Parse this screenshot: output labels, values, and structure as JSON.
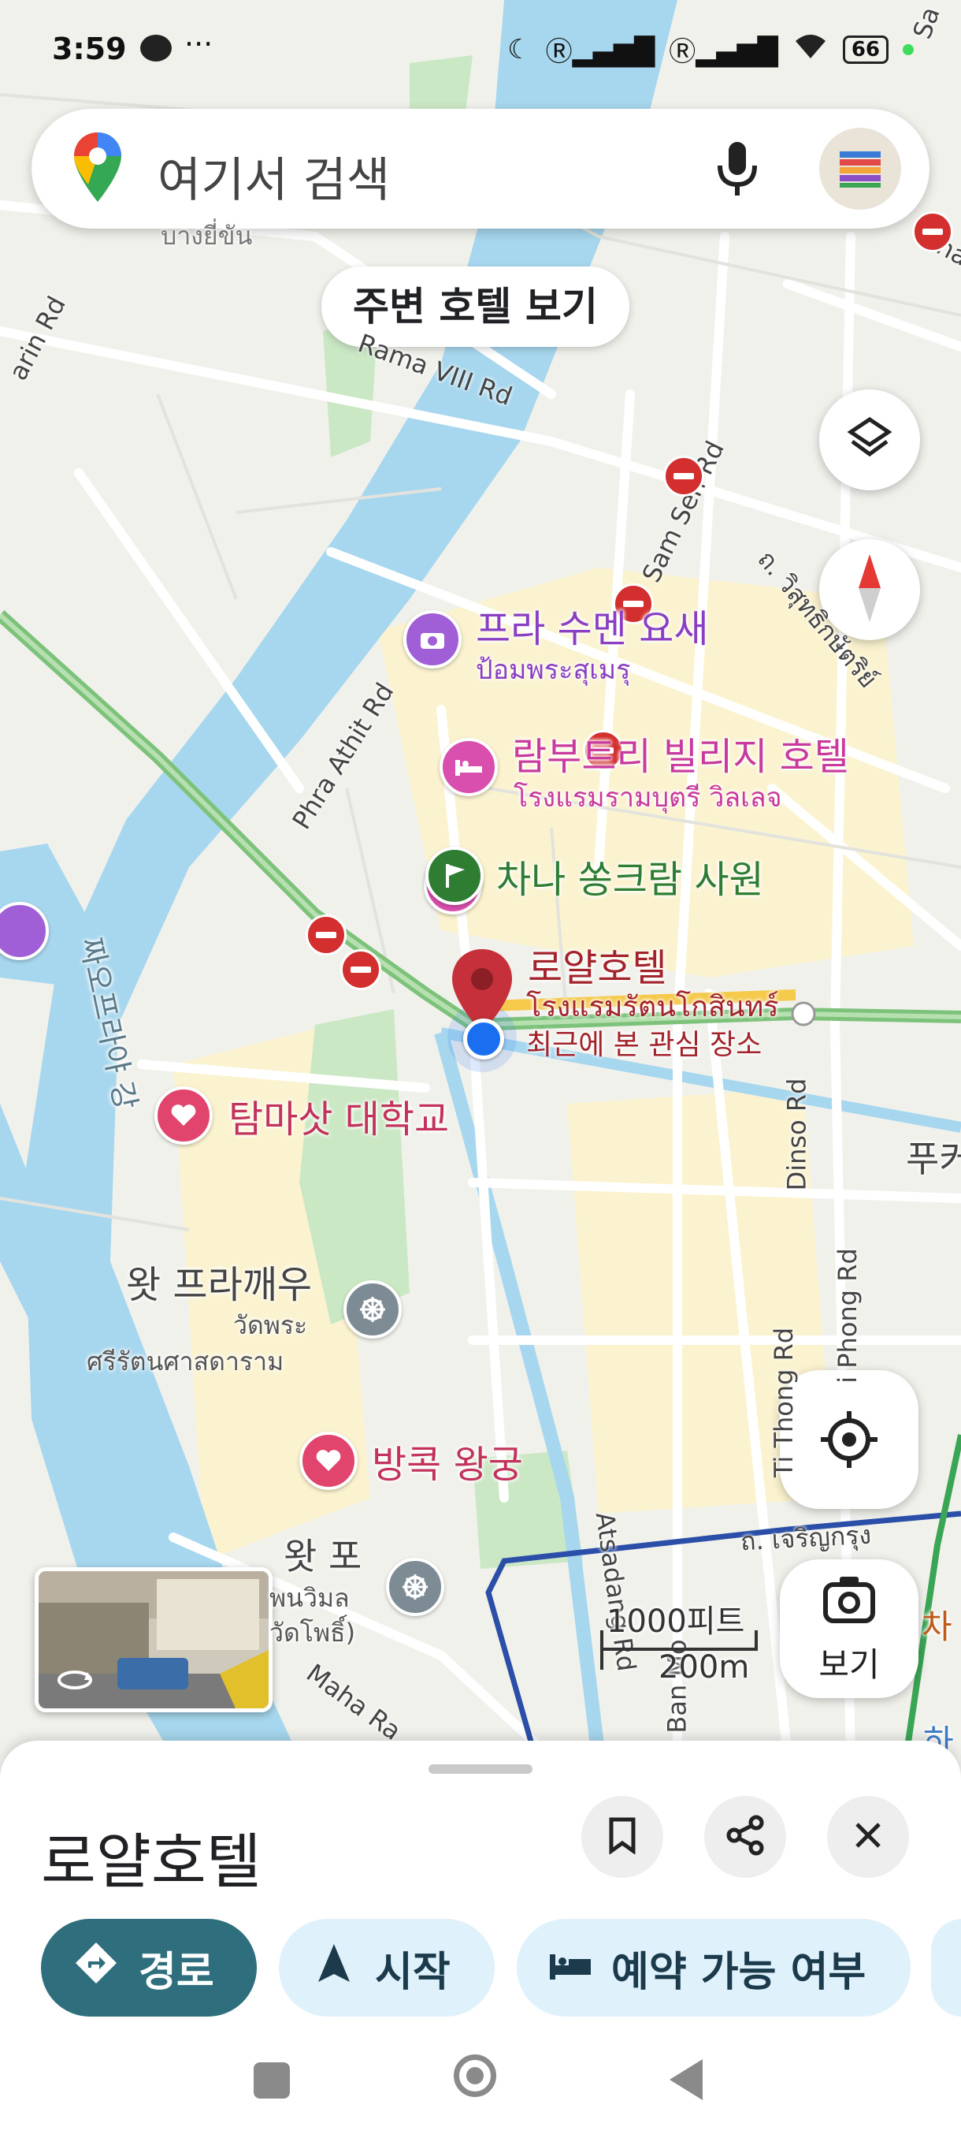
{
  "status_bar": {
    "time": "3:59",
    "battery": "66"
  },
  "search": {
    "placeholder": "여기서 검색"
  },
  "chip": {
    "label": "주변 호텔 보기"
  },
  "map_labels": {
    "phra_sumen": "프라 수멘 요새",
    "phra_sumen_th": "ป้อมพระสุเมรุ",
    "lamphu_village": "람부트리 빌리지 호텔",
    "lamphu_village_th": "โรงแรมรามบุตรี วิลเลจ",
    "chana_songkhram": "차나 쏭크람 사원",
    "royal_hotel": "로얄호텔",
    "royal_hotel_th": "โรงแรมรัตนโกสินทร์",
    "recent_view": "최근에 본 관심 장소",
    "thammasat": "탐마삿 대학교",
    "wat_phra_kaew": "왓 프라깨우",
    "wat_phra_kaew_th1": "วัดพระ",
    "wat_phra_kaew_th2": "ศรีรัตนศาสดาราม",
    "grand_palace": "방콕 왕궁",
    "wat_pho": "왓 포",
    "wat_pho_th1": "พนวิมล",
    "wat_pho_th2": "วัดโพธิ์)",
    "river": "짜오프라야 강",
    "puchi": "푸커",
    "chaophraya_cut": "บางยี่ขัน",
    "rama8": "Rama VIII Rd",
    "sam_sen": "Sam Sen Rd",
    "phra_athit": "Phra Athit Rd",
    "dinso": "Dinso Rd",
    "ti_thong": "Ti Thong Rd",
    "phong": "i Phong Rd",
    "atsadang": "Atsadang Rd",
    "ban_mo": "Ban Mo",
    "maha_rat": "Maha Ra",
    "arun_rd": "arin Rd",
    "thanon": "Than",
    "wisut": "ถ. วิสุทธิกษัตริย์",
    "charoen_krung": "ถ. เจริญกรุง",
    "sa": "Sa",
    "cha": "차",
    "ha": "하"
  },
  "scale": {
    "feet": "1000피트",
    "meters": "200m"
  },
  "fab": {
    "view_label": "보기"
  },
  "sheet": {
    "title": "로얄호텔"
  },
  "actions": {
    "directions": "경로",
    "start": "시작",
    "availability": "예약 가능 여부"
  },
  "colors": {
    "accent_dark": "#2f6f7d",
    "chip_light": "#dff1fb",
    "pin_red": "#c5303a",
    "poi_purple": "#a05fd6",
    "poi_pink": "#d94fae",
    "park_green": "#2e7d32",
    "heart_pink": "#e1446c"
  }
}
